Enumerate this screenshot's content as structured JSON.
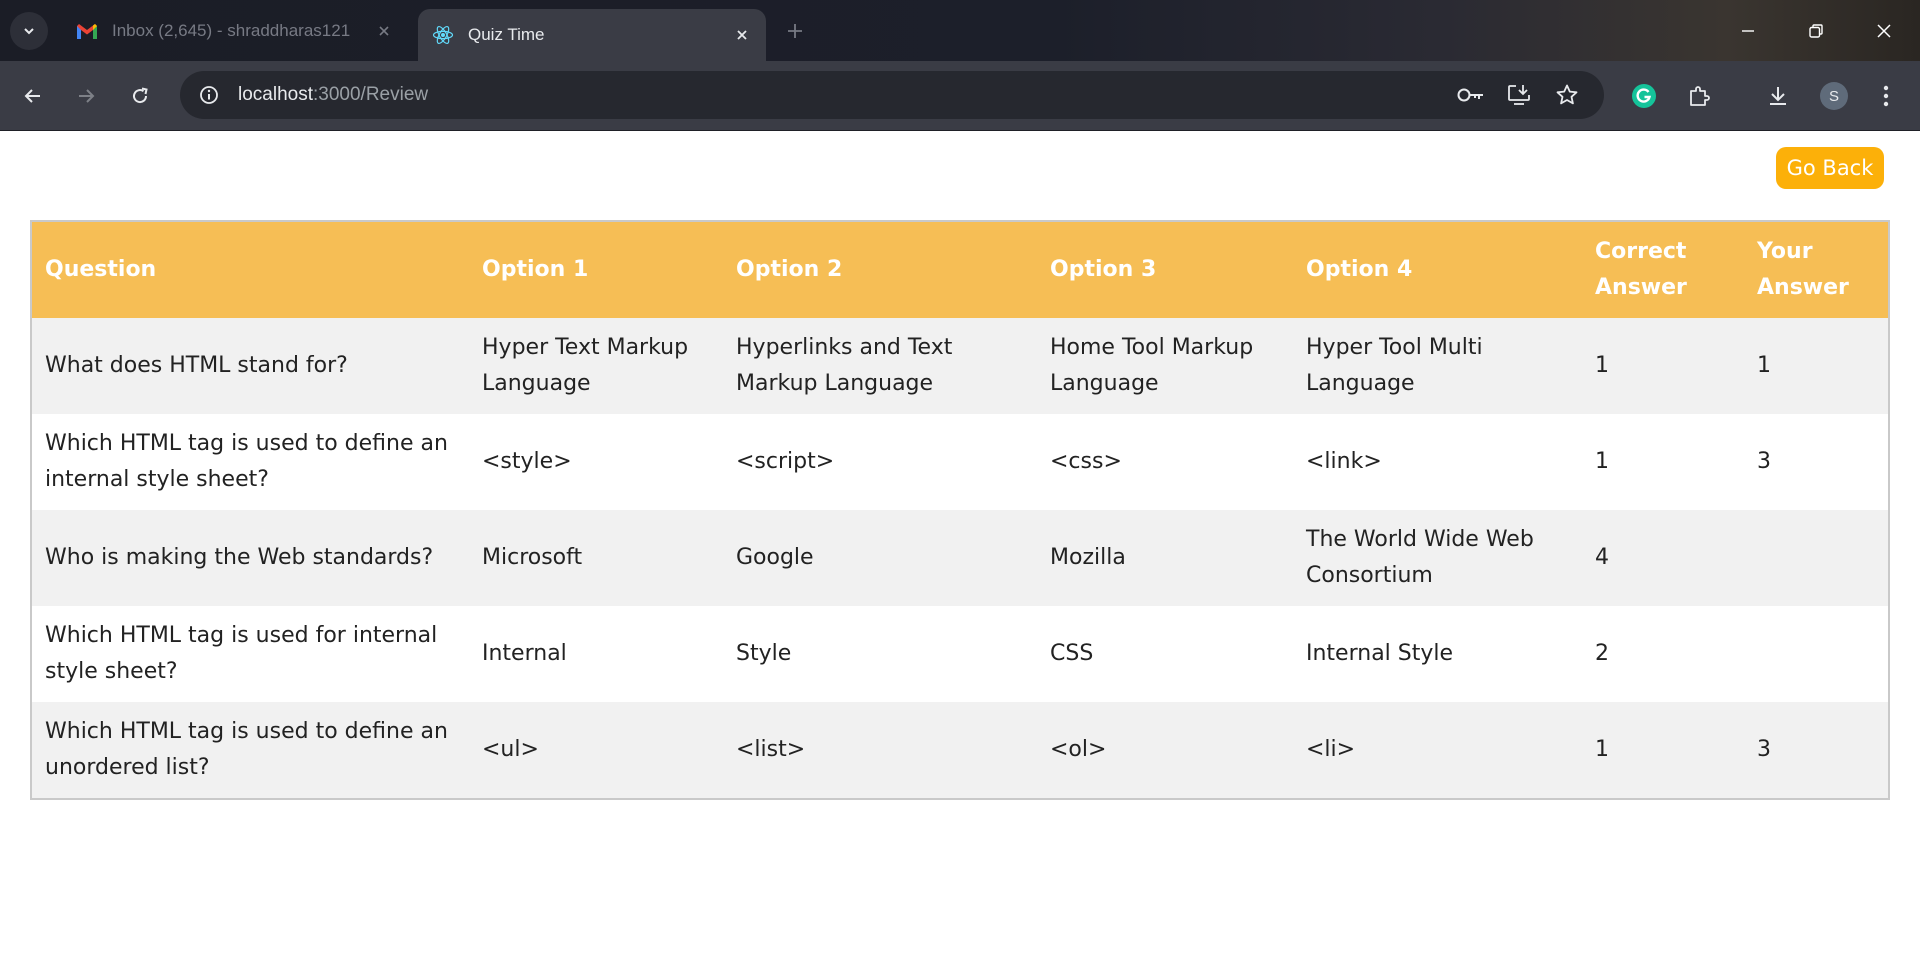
{
  "browser": {
    "tabs": [
      {
        "title": "Inbox (2,645) - shraddharas121",
        "icon": "gmail-icon",
        "active": false
      },
      {
        "title": "Quiz Time",
        "icon": "react-icon",
        "active": true
      }
    ],
    "url_host": "localhost",
    "url_path": ":3000/Review",
    "profile_initial": "S"
  },
  "page": {
    "go_back_label": "Go Back",
    "accent_color": "#fcb009",
    "header_color": "#f6be55"
  },
  "table": {
    "headers": [
      "Question",
      "Option 1",
      "Option 2",
      "Option 3",
      "Option 4",
      "Correct Answer",
      "Your Answer"
    ],
    "rows": [
      {
        "question": "What does HTML stand for?",
        "option1": "Hyper Text Markup Language",
        "option2": "Hyperlinks and Text Markup Language",
        "option3": "Home Tool Markup Language",
        "option4": "Hyper Tool Multi Language",
        "correct": "1",
        "yours": "1"
      },
      {
        "question": "Which HTML tag is used to define an internal style sheet?",
        "option1": "<style>",
        "option2": "<script>",
        "option3": "<css>",
        "option4": "<link>",
        "correct": "1",
        "yours": "3"
      },
      {
        "question": "Who is making the Web standards?",
        "option1": "Microsoft",
        "option2": "Google",
        "option3": "Mozilla",
        "option4": "The World Wide Web Consortium",
        "correct": "4",
        "yours": ""
      },
      {
        "question": "Which HTML tag is used for internal style sheet?",
        "option1": "Internal",
        "option2": "Style",
        "option3": "CSS",
        "option4": "Internal Style",
        "correct": "2",
        "yours": ""
      },
      {
        "question": "Which HTML tag is used to define an unordered list?",
        "option1": "<ul>",
        "option2": "<list>",
        "option3": "<ol>",
        "option4": "<li>",
        "correct": "1",
        "yours": "3"
      }
    ]
  }
}
